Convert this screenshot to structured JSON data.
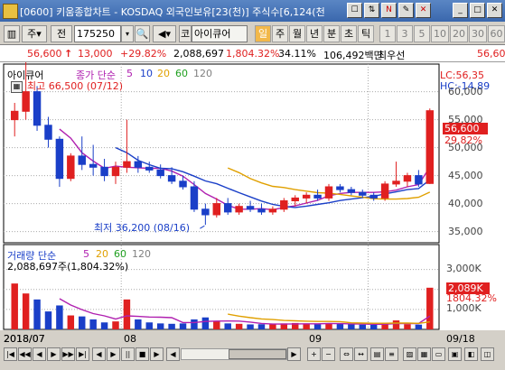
{
  "window": {
    "title": "[0600] 키움종합차트 - KOSDAQ 외국인보유[23(천)] 주식수[6,124(천",
    "buttons": [
      "☐",
      "⇅",
      "N",
      "✎",
      "✕",
      "_",
      "□",
      "✕"
    ]
  },
  "toolbar": {
    "mode_label": "주",
    "period_label": "전",
    "code_value": "175250",
    "stock_prefix": "코",
    "stock_name": "아이큐어",
    "tabs": [
      "일",
      "주",
      "월",
      "년",
      "분",
      "초",
      "틱"
    ],
    "num_tabs": [
      "1",
      "3",
      "5",
      "10",
      "20",
      "30",
      "60"
    ]
  },
  "info": {
    "price": "56,600",
    "change": "13,000",
    "change_pct": "+29.82%",
    "volume": "2,088,697",
    "volume_pct": "1,804.32%",
    "turnover": "34.11%",
    "amount": "106,492백만",
    "tag": "최우선",
    "tail_value": "56,60"
  },
  "price_chart": {
    "stock_label": "아이큐어",
    "ma_label": "종가 단순",
    "ma_periods": [
      "5",
      "10",
      "20",
      "60",
      "120"
    ],
    "high_label": "최고 66,500 (07/12)",
    "low_label": "최저 36,200 (08/16)",
    "lc": "LC:56,35",
    "hc": "HC:-14,89",
    "last_price": "56,600",
    "last_pct": "29.82%",
    "y_ticks": [
      "60,000",
      "55,000",
      "50,000",
      "45,000",
      "40,000",
      "35,000"
    ]
  },
  "volume_chart": {
    "label": "거래량 단순",
    "ma_periods": [
      "5",
      "20",
      "60",
      "120"
    ],
    "summary": "2,088,697주(1,804.32%)",
    "y_ticks": [
      "3,000K",
      "2,000K",
      "1,000K"
    ],
    "last_vol": "2,089K",
    "last_pct": "1804.32%"
  },
  "x_axis": {
    "labels": [
      "2018/07",
      "08",
      "09",
      "09/18"
    ]
  },
  "colors": {
    "up": "#e02020",
    "down": "#1a3fc8",
    "ma5": "#b020b0",
    "ma10": "#1a3fc8",
    "ma20": "#e0a000",
    "ma60": "#20a020",
    "ma120": "#808080"
  },
  "chart_data": {
    "type": "candlestick",
    "candles": [
      {
        "o": 55000,
        "h": 58000,
        "l": 52000,
        "c": 56500
      },
      {
        "o": 56500,
        "h": 66500,
        "l": 55000,
        "c": 60000
      },
      {
        "o": 60000,
        "h": 61000,
        "l": 53000,
        "c": 54000
      },
      {
        "o": 54000,
        "h": 55500,
        "l": 50000,
        "c": 51500
      },
      {
        "o": 51500,
        "h": 52000,
        "l": 43000,
        "c": 44500
      },
      {
        "o": 44500,
        "h": 49000,
        "l": 44000,
        "c": 48500
      },
      {
        "o": 48500,
        "h": 52000,
        "l": 46000,
        "c": 47000
      },
      {
        "o": 47000,
        "h": 50500,
        "l": 45000,
        "c": 46500
      },
      {
        "o": 46500,
        "h": 48000,
        "l": 44000,
        "c": 45000
      },
      {
        "o": 45000,
        "h": 47500,
        "l": 43500,
        "c": 46500
      },
      {
        "o": 46500,
        "h": 55000,
        "l": 45500,
        "c": 47500
      },
      {
        "o": 47500,
        "h": 48500,
        "l": 45500,
        "c": 46500
      },
      {
        "o": 46500,
        "h": 47500,
        "l": 45500,
        "c": 46000
      },
      {
        "o": 46000,
        "h": 47000,
        "l": 44500,
        "c": 45000
      },
      {
        "o": 45000,
        "h": 46500,
        "l": 43500,
        "c": 44000
      },
      {
        "o": 44000,
        "h": 45000,
        "l": 42500,
        "c": 43000
      },
      {
        "o": 43000,
        "h": 44000,
        "l": 38500,
        "c": 39000
      },
      {
        "o": 39000,
        "h": 40000,
        "l": 36200,
        "c": 38000
      },
      {
        "o": 38000,
        "h": 41000,
        "l": 37500,
        "c": 40000
      },
      {
        "o": 40000,
        "h": 41000,
        "l": 38000,
        "c": 38500
      },
      {
        "o": 38500,
        "h": 40000,
        "l": 38000,
        "c": 39500
      },
      {
        "o": 39500,
        "h": 40500,
        "l": 38500,
        "c": 39000
      },
      {
        "o": 39000,
        "h": 40000,
        "l": 38000,
        "c": 38500
      },
      {
        "o": 38500,
        "h": 39500,
        "l": 38000,
        "c": 39000
      },
      {
        "o": 39000,
        "h": 41000,
        "l": 38500,
        "c": 40500
      },
      {
        "o": 40500,
        "h": 41500,
        "l": 39500,
        "c": 41000
      },
      {
        "o": 41000,
        "h": 42000,
        "l": 40000,
        "c": 41500
      },
      {
        "o": 41500,
        "h": 42500,
        "l": 40500,
        "c": 41000
      },
      {
        "o": 41000,
        "h": 43500,
        "l": 40500,
        "c": 43000
      },
      {
        "o": 43000,
        "h": 43500,
        "l": 42000,
        "c": 42500
      },
      {
        "o": 42500,
        "h": 43000,
        "l": 41500,
        "c": 42000
      },
      {
        "o": 42000,
        "h": 42500,
        "l": 41000,
        "c": 41500
      },
      {
        "o": 41500,
        "h": 42000,
        "l": 40500,
        "c": 41000
      },
      {
        "o": 41000,
        "h": 44000,
        "l": 40500,
        "c": 43500
      },
      {
        "o": 43500,
        "h": 47500,
        "l": 43000,
        "c": 44000
      },
      {
        "o": 44000,
        "h": 45500,
        "l": 43000,
        "c": 45000
      },
      {
        "o": 45000,
        "h": 46000,
        "l": 43000,
        "c": 43500
      },
      {
        "o": 43600,
        "h": 57000,
        "l": 43500,
        "c": 56600
      }
    ],
    "volumes": [
      2300,
      1800,
      1500,
      900,
      1200,
      700,
      650,
      500,
      350,
      400,
      1500,
      500,
      350,
      300,
      280,
      300,
      500,
      600,
      400,
      300,
      280,
      250,
      260,
      250,
      300,
      320,
      280,
      260,
      300,
      280,
      250,
      240,
      230,
      300,
      450,
      260,
      240,
      2089
    ],
    "y_range": [
      33000,
      63000
    ],
    "volume_range": [
      0,
      3800
    ]
  }
}
